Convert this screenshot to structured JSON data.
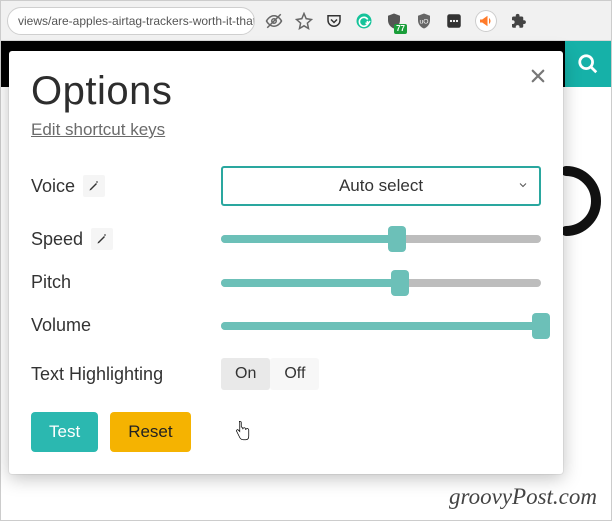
{
  "chrome": {
    "url": "views/are-apples-airtag-trackers-worth-it-that-d…",
    "badge77": "77"
  },
  "page": {
    "watermark": "groovyPost.com"
  },
  "panel": {
    "title": "Options",
    "shortcut_link": "Edit shortcut keys",
    "labels": {
      "voice": "Voice",
      "speed": "Speed",
      "pitch": "Pitch",
      "volume": "Volume",
      "highlight": "Text Highlighting"
    },
    "voice": {
      "selected": "Auto select"
    },
    "sliders": {
      "speed_pct": 55,
      "pitch_pct": 56,
      "volume_pct": 100
    },
    "highlight": {
      "on": "On",
      "off": "Off",
      "value": "on"
    },
    "buttons": {
      "test": "Test",
      "reset": "Reset"
    }
  }
}
